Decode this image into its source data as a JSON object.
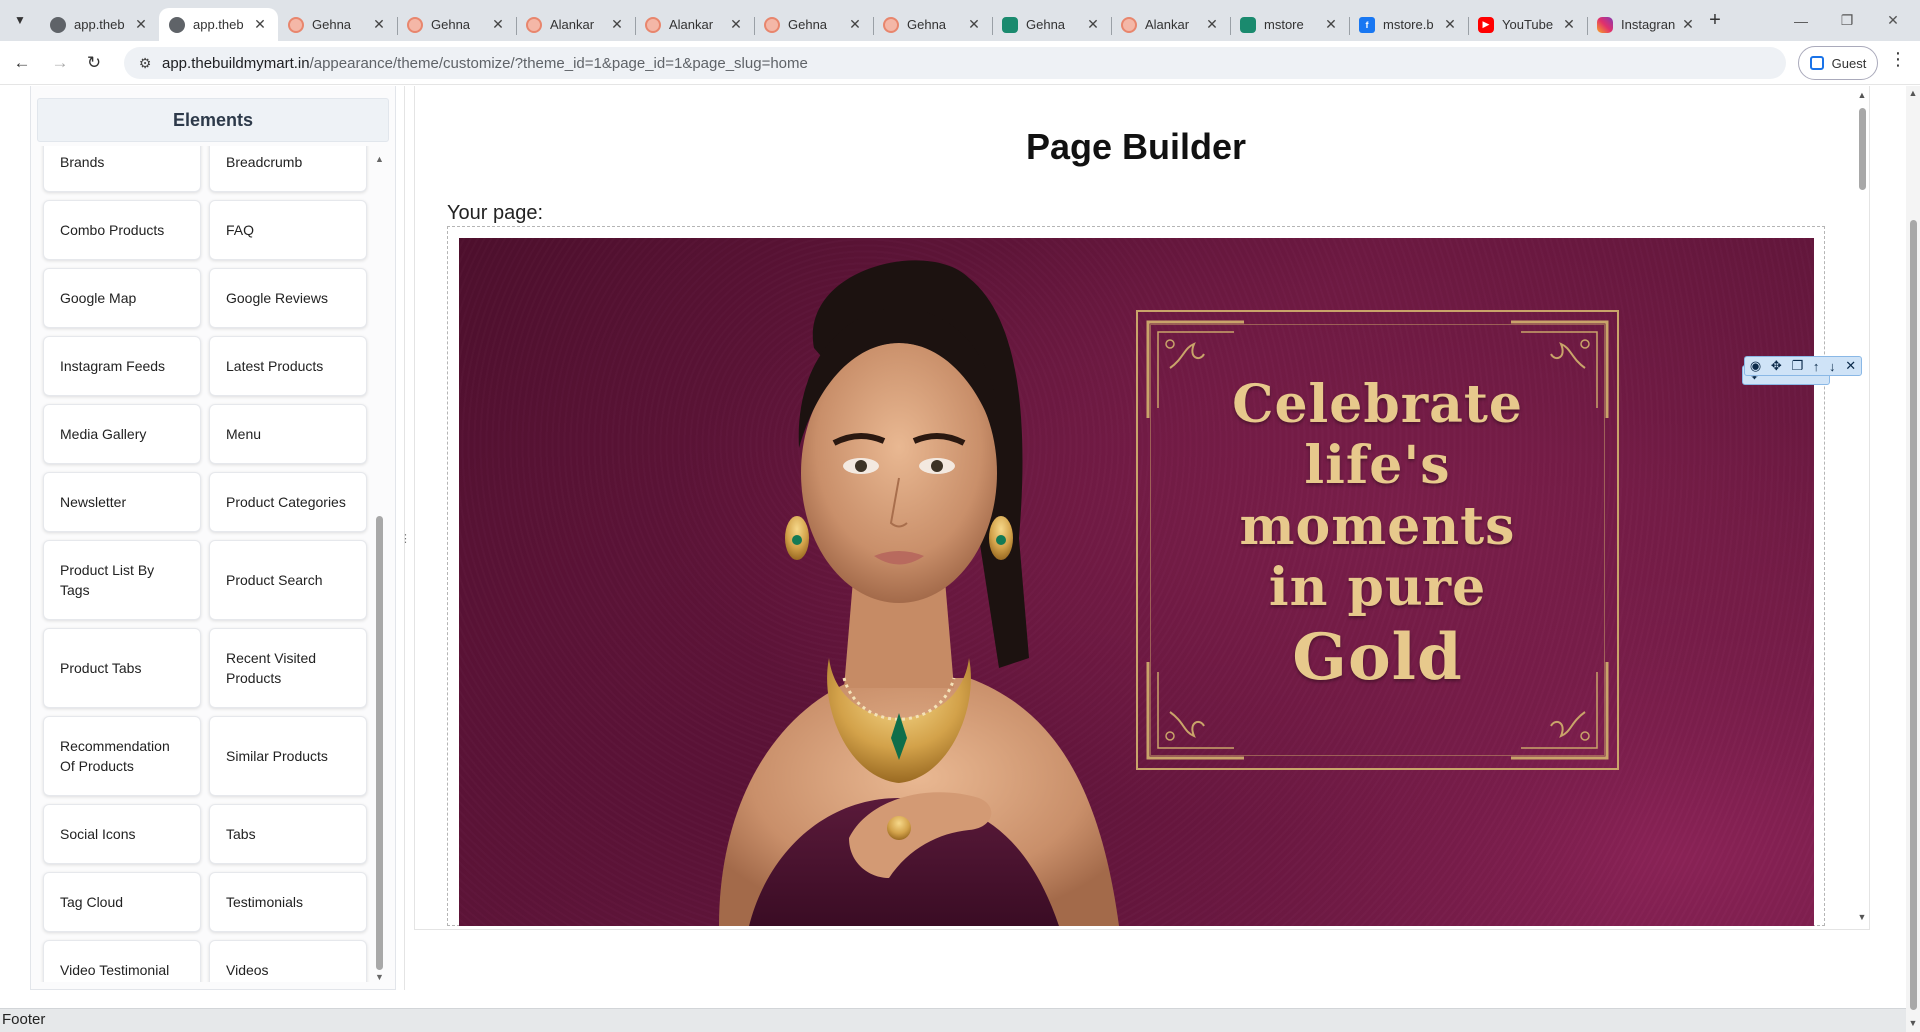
{
  "browser": {
    "tabs": [
      {
        "label": "app.theb",
        "favicon": "globe-icon",
        "active": false
      },
      {
        "label": "app.theb",
        "favicon": "globe-icon",
        "active": true
      },
      {
        "label": "Gehna",
        "favicon": "gehna-icon",
        "active": false
      },
      {
        "label": "Gehna",
        "favicon": "gehna-icon",
        "active": false
      },
      {
        "label": "Alankar",
        "favicon": "gehna-icon",
        "active": false
      },
      {
        "label": "Alankar",
        "favicon": "gehna-icon",
        "active": false
      },
      {
        "label": "Gehna",
        "favicon": "gehna-icon",
        "active": false
      },
      {
        "label": "Gehna",
        "favicon": "gehna-icon",
        "active": false
      },
      {
        "label": "Gehna",
        "favicon": "mstore-icon",
        "active": false
      },
      {
        "label": "Alankar",
        "favicon": "gehna-icon",
        "active": false
      },
      {
        "label": "mstore",
        "favicon": "mstore-icon",
        "active": false
      },
      {
        "label": "mstore.b",
        "favicon": "facebook-icon",
        "active": false
      },
      {
        "label": "YouTube",
        "favicon": "youtube-icon",
        "active": false
      },
      {
        "label": "Instagran",
        "favicon": "instagram-icon",
        "active": false
      }
    ],
    "url_host": "app.thebuildmymart.in",
    "url_path": "/appearance/theme/customize/?theme_id=1&page_id=1&page_slug=home",
    "profile_label": "Guest"
  },
  "sidebar": {
    "title": "Elements",
    "items": [
      "Brands",
      "Breadcrumb",
      "Combo Products",
      "FAQ",
      "Google Map",
      "Google Reviews",
      "Instagram Feeds",
      "Latest Products",
      "Media Gallery",
      "Menu",
      "Newsletter",
      "Product Categories",
      "Product List By Tags",
      "Product Search",
      "Product Tabs",
      "Recent Visited Products",
      "Recommendation Of Products",
      "Similar Products",
      "Social Icons",
      "Tabs",
      "Tag Cloud",
      "Testimonials",
      "Video Testimonial",
      "Videos"
    ]
  },
  "builder": {
    "title": "Page Builder",
    "your_page_label": "Your page:",
    "hero": {
      "lines": [
        "Celebrate",
        "life's",
        "moments",
        "in pure"
      ],
      "last_line": "Gold",
      "text_color": "#e7c98c",
      "background_color": "#5e1538"
    },
    "element_toolbar_icons": [
      "move-icon",
      "eye-icon",
      "move-icon",
      "copy-icon",
      "arrow-up-icon",
      "arrow-down-icon",
      "close-icon"
    ]
  },
  "footer": {
    "label": "Footer"
  }
}
